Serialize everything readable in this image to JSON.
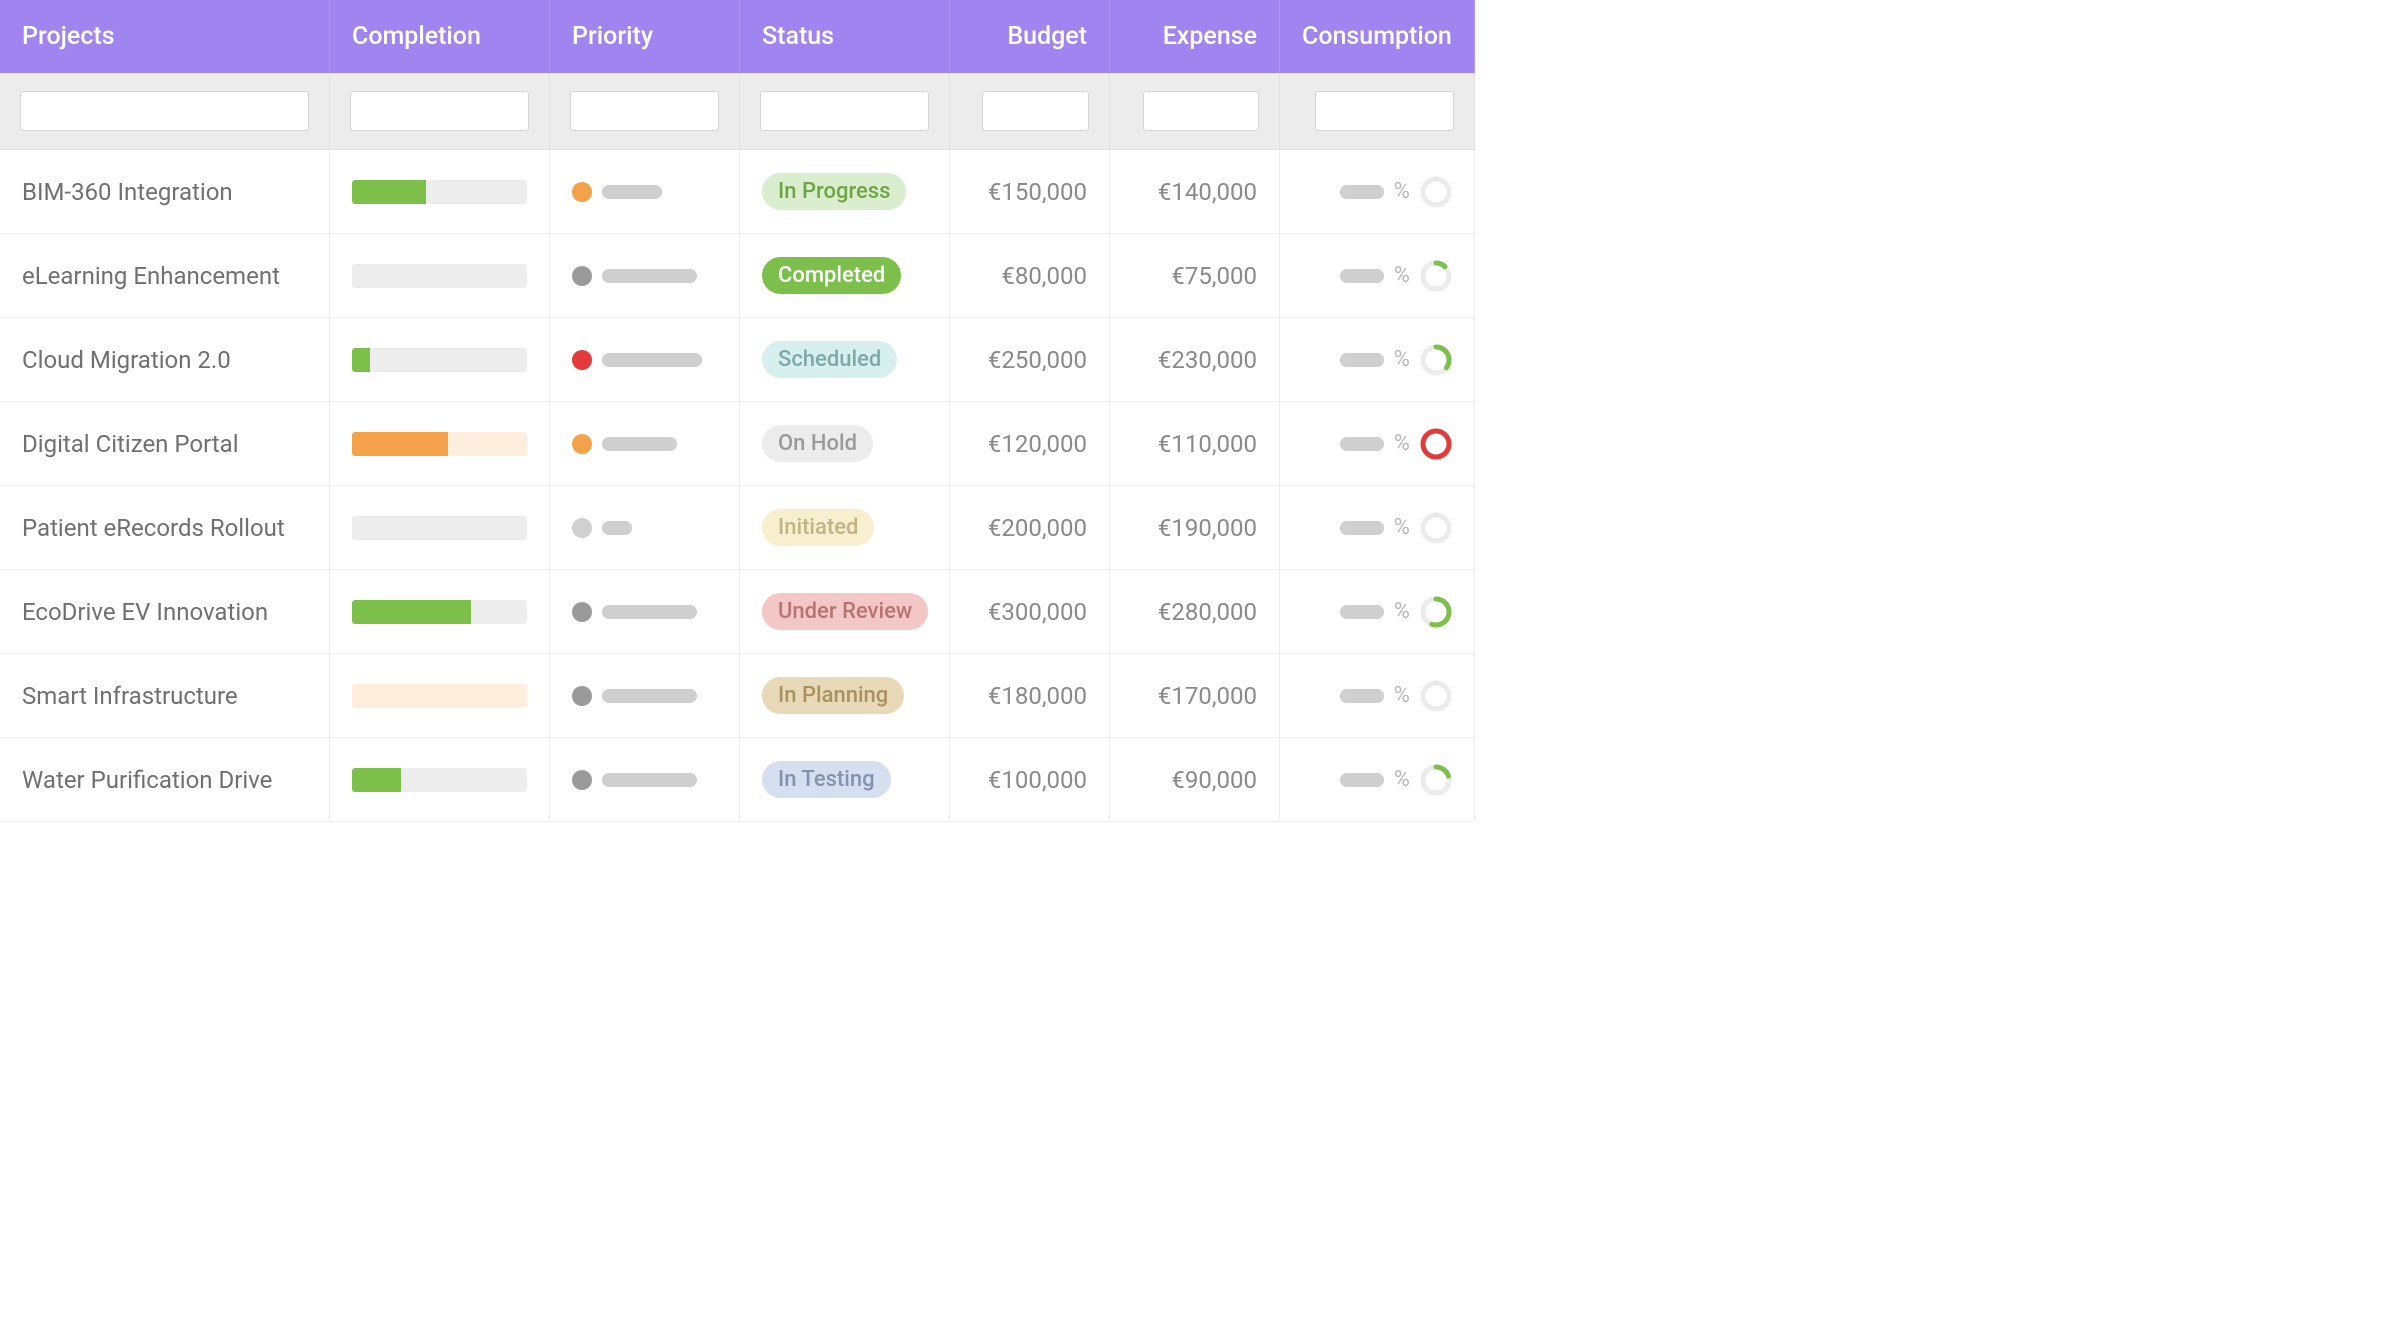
{
  "headers": {
    "projects": "Projects",
    "completion": "Completion",
    "priority": "Priority",
    "status": "Status",
    "budget": "Budget",
    "expense": "Expense",
    "consumption": "Consumption"
  },
  "consumption_unit": "%",
  "rows": [
    {
      "name": "BIM-360 Integration",
      "completion_pct": 42,
      "completion_color": "green",
      "priority_color": "orange",
      "priority_len": 60,
      "status_text": "In Progress",
      "status_class": "in-progress",
      "budget": "€150,000",
      "expense": "€140,000",
      "ring_pct": 0,
      "ring_color": "#e8e8e8"
    },
    {
      "name": "eLearning Enhancement",
      "completion_pct": 0,
      "completion_color": "green",
      "priority_color": "grey",
      "priority_len": 95,
      "status_text": "Completed",
      "status_class": "completed",
      "budget": "€80,000",
      "expense": "€75,000",
      "ring_pct": 12,
      "ring_color": "#7cc04b"
    },
    {
      "name": "Cloud Migration 2.0",
      "completion_pct": 10,
      "completion_color": "green",
      "priority_color": "red",
      "priority_len": 100,
      "status_text": "Scheduled",
      "status_class": "scheduled",
      "budget": "€250,000",
      "expense": "€230,000",
      "ring_pct": 35,
      "ring_color": "#7cc04b"
    },
    {
      "name": "Digital Citizen Portal",
      "completion_pct": 55,
      "completion_color": "orange",
      "completion_track": "orange-track",
      "priority_color": "orange",
      "priority_len": 75,
      "status_text": "On Hold",
      "status_class": "on-hold",
      "budget": "€120,000",
      "expense": "€110,000",
      "ring_pct": 100,
      "ring_color": "#e23b3b"
    },
    {
      "name": "Patient eRecords Rollout",
      "completion_pct": 0,
      "completion_color": "green",
      "priority_color": "lgrey",
      "priority_len": 30,
      "status_text": "Initiated",
      "status_class": "initiated",
      "budget": "€200,000",
      "expense": "€190,000",
      "ring_pct": 0,
      "ring_color": "#e8e8e8"
    },
    {
      "name": "EcoDrive EV Innovation",
      "completion_pct": 68,
      "completion_color": "green",
      "priority_color": "grey",
      "priority_len": 95,
      "status_text": "Under Review",
      "status_class": "under-review",
      "budget": "€300,000",
      "expense": "€280,000",
      "ring_pct": 55,
      "ring_color": "#7cc04b"
    },
    {
      "name": "Smart Infrastructure",
      "completion_pct": 0,
      "completion_color": "orange",
      "completion_track": "orange-track",
      "priority_color": "grey",
      "priority_len": 95,
      "status_text": "In Planning",
      "status_class": "in-planning",
      "budget": "€180,000",
      "expense": "€170,000",
      "ring_pct": 0,
      "ring_color": "#e8e8e8"
    },
    {
      "name": "Water Purification Drive",
      "completion_pct": 28,
      "completion_color": "green",
      "priority_color": "grey",
      "priority_len": 95,
      "status_text": "In Testing",
      "status_class": "in-testing",
      "budget": "€100,000",
      "expense": "€90,000",
      "ring_pct": 20,
      "ring_color": "#7cc04b"
    }
  ]
}
